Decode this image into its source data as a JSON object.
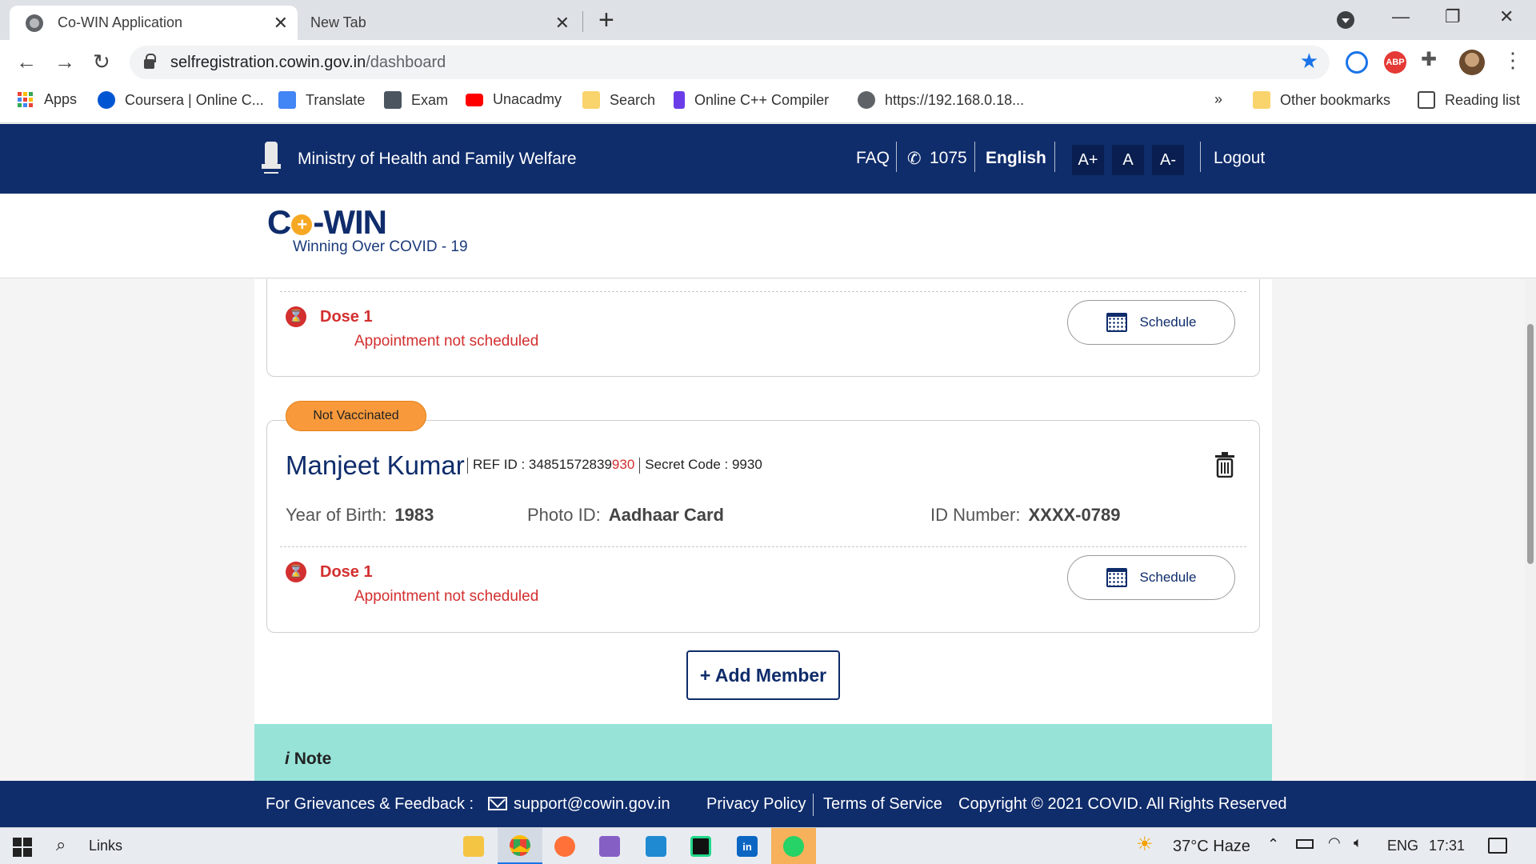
{
  "browser": {
    "tabs": [
      {
        "title": "Co-WIN Application",
        "active": true
      },
      {
        "title": "New Tab",
        "active": false
      }
    ],
    "new_tab_icon": "+",
    "url_host": "selfregistration.cowin.gov.in",
    "url_path": "/dashboard",
    "bookmarks": [
      {
        "label": "Apps",
        "icon": "apps-grid-icon"
      },
      {
        "label": "Coursera | Online C...",
        "icon": "coursera-icon"
      },
      {
        "label": "Translate",
        "icon": "translate-icon"
      },
      {
        "label": "Exam",
        "icon": "exam-icon"
      },
      {
        "label": "Unacadmy",
        "icon": "youtube-icon"
      },
      {
        "label": "Search",
        "icon": "folder-icon"
      },
      {
        "label": "Online C++ Compiler",
        "icon": "compiler-icon"
      },
      {
        "label": "https://192.168.0.18...",
        "icon": "globe-icon"
      }
    ],
    "overflow": "»",
    "other_bookmarks": "Other bookmarks",
    "reading_list": "Reading list",
    "extension_abp": "ABP"
  },
  "site": {
    "ministry": "Ministry of Health and Family Welfare",
    "nav": {
      "faq": "FAQ",
      "helpline": "1075",
      "language": "English",
      "font_plus": "A+",
      "font_normal": "A",
      "font_minus": "A-",
      "logout": "Logout"
    },
    "logo": {
      "co": "C",
      "plus": "+",
      "win": "-WIN",
      "tagline": "Winning Over COVID - 19"
    }
  },
  "members": [
    {
      "dose": {
        "label": "Dose 1",
        "status": "Appointment not scheduled",
        "button": "Schedule"
      }
    },
    {
      "badge": "Not Vaccinated",
      "name": "Manjeet Kumar",
      "ref_label": "REF ID : ",
      "ref_prefix": "34851572839",
      "ref_suffix": "930",
      "secret_label": "Secret Code : 9930",
      "year_label": "Year of Birth:",
      "year_value": "1983",
      "photo_label": "Photo ID:",
      "photo_value": "Aadhaar Card",
      "id_label": "ID Number:",
      "id_value": "XXXX-0789",
      "dose": {
        "label": "Dose 1",
        "status": "Appointment not scheduled",
        "button": "Schedule"
      }
    }
  ],
  "add_member": "+ Add Member",
  "note": {
    "icon": "i",
    "title": "Note"
  },
  "footer": {
    "grievance": "For Grievances & Feedback :",
    "email": "support@cowin.gov.in",
    "privacy": "Privacy Policy",
    "terms": "Terms of Service",
    "copyright": "Copyright © 2021 COVID. All Rights Reserved"
  },
  "taskbar": {
    "search_label": "Links",
    "weather": "37°C  Haze",
    "lang": "ENG",
    "time": "17:31"
  },
  "colors": {
    "navy": "#0f2c6b",
    "alert_red": "#d32f2f",
    "badge_orange": "#f89a3c",
    "note_teal": "#97e3d8"
  }
}
